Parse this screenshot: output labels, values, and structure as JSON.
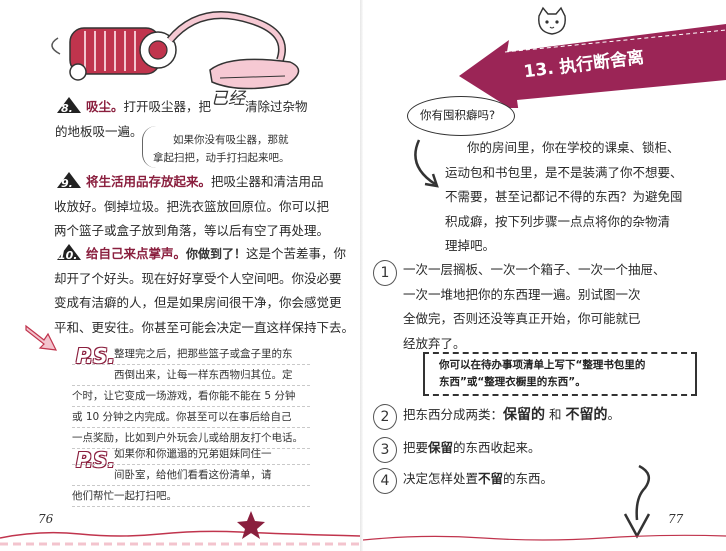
{
  "left_page": {
    "step8": {
      "number": "8.",
      "heading": "吸尘。",
      "text_a": "打开吸尘器，把",
      "overlay_handwritten": "已经",
      "text_b": "清除过杂物",
      "text_line2": "的地板吸一遍。"
    },
    "aside_note": {
      "line1": "如果你没有吸尘器，那就",
      "line2": "拿起扫把，动手打扫起来吧。"
    },
    "step9": {
      "number": "9.",
      "heading": "将生活用品存放起来。",
      "lines": [
        "把吸尘器和清洁用品",
        "收放好。倒掉垃圾。把洗衣篮放回原位。你可以把",
        "两个篮子或盒子放到角落，等以后有空了再处理。"
      ]
    },
    "step10": {
      "number": "10.",
      "heading": "给自己来点掌声。",
      "handwritten": "你做到了！",
      "lines": [
        "这是个苦差事，你",
        "却开了个好头。现在好好享受个人空间吧。你没必要",
        "变成有洁癖的人，但是如果房间很干净，你会感觉更",
        "平和、更安往。你甚至可能会决定一直这样保持下去。"
      ]
    },
    "ps1": {
      "tag": "P.S.",
      "lines": [
        "整理完之后，把那些篮子或盒子里的东",
        "西倒出来，让每一样东西物归其位。定",
        "个时，让它变成一场游戏，看你能不能在 5 分钟",
        "或 10 分钟之内完成。你甚至可以在事后给自己",
        "一点奖励，比如到户外玩会儿或给朋友打个电话。"
      ]
    },
    "ps2": {
      "tag": "P.S.",
      "lines": [
        "如果你和你邋遢的兄弟姐妹同住一",
        "间卧室，给他们看看这份清单，请",
        "他们帮忙一起打扫吧。"
      ]
    },
    "page_number": "76"
  },
  "right_page": {
    "banner": {
      "title": "13. 执行断舍离"
    },
    "speech_bubble": "你有囤积癖吗?",
    "intro": {
      "lines": [
        "你的房间里，你在学校的课桌、锁柜、",
        "运动包和书包里，是不是装满了你不想要、",
        "不需要，甚至记都记不得的东西？为避免囤",
        "积成癖，按下列步骤一点点将你的杂物清",
        "理掉吧。"
      ]
    },
    "steps": [
      {
        "num": "1",
        "lines": [
          "一次一层搁板、一次一个箱子、一次一个抽屉、",
          "一次一堆地把你的东西理一遍。别试图一次",
          "全做完，否则还没等真正开始，你可能就已",
          "经放弃了。"
        ]
      },
      {
        "num": "2",
        "text_a": "把东西分成两类：",
        "hand_a": "保留的",
        "text_b": "和",
        "hand_b": "不留的",
        "text_c": "。"
      },
      {
        "num": "3",
        "text_a": "把要",
        "bold": "保留",
        "text_b": "的东西收起来。"
      },
      {
        "num": "4",
        "text_a": "决定怎样处置",
        "bold": "不留",
        "text_b": "的东西。"
      }
    ],
    "handwritten_tip": {
      "line1": "你可以在待办事项清单上写下“整理书包里的",
      "line2": "东西”或“整理衣橱里的东西”。"
    },
    "page_number": "77"
  },
  "colors": {
    "accent": "#8a1f3e",
    "banner": "#9b2556",
    "star": "#8a1f3e",
    "text": "#2a2a2a"
  }
}
